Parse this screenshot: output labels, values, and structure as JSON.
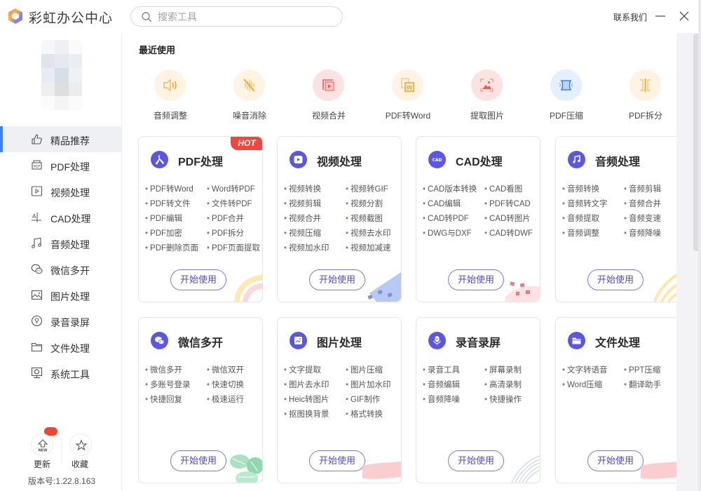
{
  "app": {
    "title": "彩虹办公中心",
    "contact_label": "联系我们",
    "minimize_icon": "minimize-icon",
    "close_icon": "close-icon"
  },
  "search": {
    "placeholder": "搜索工具",
    "value": "",
    "icon": "search-icon"
  },
  "sidebar": {
    "active_index": 0,
    "accent_color": "#3b82f6",
    "items": [
      {
        "label": "精品推荐",
        "icon": "thumbs-up-icon"
      },
      {
        "label": "PDF处理",
        "icon": "pdf-file-icon"
      },
      {
        "label": "视频处理",
        "icon": "video-play-icon"
      },
      {
        "label": "CAD处理",
        "icon": "cad-icon"
      },
      {
        "label": "音频处理",
        "icon": "music-note-icon"
      },
      {
        "label": "微信多开",
        "icon": "wechat-icon"
      },
      {
        "label": "图片处理",
        "icon": "image-icon"
      },
      {
        "label": "录音录屏",
        "icon": "record-icon"
      },
      {
        "label": "文件处理",
        "icon": "folder-icon"
      },
      {
        "label": "系统工具",
        "icon": "monitor-gear-icon"
      }
    ],
    "update_label": "更新",
    "update_icon_text": "NEW",
    "favorites_label": "收藏",
    "version": "版本号:1.22.8.163"
  },
  "recent": {
    "title": "最近使用",
    "items": [
      {
        "label": "音频调整",
        "icon": "speaker-icon",
        "bg": "#fff4e6",
        "fg": "#f8b35a"
      },
      {
        "label": "噪音消除",
        "icon": "noise-off-icon",
        "bg": "#fff4e6",
        "fg": "#f5a623"
      },
      {
        "label": "视频合并",
        "icon": "video-merge-icon",
        "bg": "#fde4e4",
        "fg": "#ef5b5b"
      },
      {
        "label": "PDF转Word",
        "icon": "pdf-to-word-icon",
        "bg": "#fff4e6",
        "fg": "#f5a623"
      },
      {
        "label": "提取图片",
        "icon": "extract-image-icon",
        "bg": "#fde4e4",
        "fg": "#ef5b5b"
      },
      {
        "label": "PDF压缩",
        "icon": "pdf-compress-icon",
        "bg": "#e6f0ff",
        "fg": "#3b82f6"
      },
      {
        "label": "PDF拆分",
        "icon": "pdf-split-icon",
        "bg": "#fff4e6",
        "fg": "#f5a623"
      }
    ]
  },
  "cards": [
    {
      "title": "PDF处理",
      "icon": "pdf-acrobat-icon",
      "badge": "HOT",
      "features": [
        "PDF转Word",
        "Word转PDF",
        "PDF转文件",
        "文件转PDF",
        "PDF编辑",
        "PDF合并",
        "PDF加密",
        "PDF拆分",
        "PDF删除页面",
        "PDF页面提取"
      ],
      "button": "开始使用"
    },
    {
      "title": "视频处理",
      "icon": "video-play-icon",
      "features": [
        "视频转换",
        "视频转GIF",
        "视频剪辑",
        "视频分割",
        "视频合并",
        "视频截图",
        "视频压缩",
        "视频去水印",
        "视频加水印",
        "视频加减速"
      ],
      "button": "开始使用"
    },
    {
      "title": "CAD处理",
      "icon": "cad-badge-icon",
      "features": [
        "CAD版本转换",
        "CAD看图",
        "CAD编辑",
        "PDF转CAD",
        "CAD转PDF",
        "CAD转图片",
        "DWG与DXF",
        "CAD转DWF"
      ],
      "button": "开始使用"
    },
    {
      "title": "音频处理",
      "icon": "music-note-icon",
      "features": [
        "音频转换",
        "音频剪辑",
        "音频转文字",
        "音频合并",
        "音频提取",
        "音频变速",
        "音频调整",
        "音频降噪"
      ],
      "button": "开始使用"
    },
    {
      "title": "微信多开",
      "icon": "wechat-icon",
      "features": [
        "微信多开",
        "微信双开",
        "多账号登录",
        "快速切换",
        "快捷回复",
        "极速运行"
      ],
      "button": "开始使用"
    },
    {
      "title": "图片处理",
      "icon": "image-icon",
      "features": [
        "文字提取",
        "图片压缩",
        "图片去水印",
        "图片加水印",
        "Heic转图片",
        "GIF制作",
        "抠图换背景",
        "格式转换"
      ],
      "button": "开始使用"
    },
    {
      "title": "录音录屏",
      "icon": "microphone-icon",
      "features": [
        "录音工具",
        "屏幕录制",
        "音频编辑",
        "高清录制",
        "音频降噪",
        "快捷操作"
      ],
      "button": "开始使用"
    },
    {
      "title": "文件处理",
      "icon": "folder-icon",
      "features": [
        "文字转语音",
        "PPT压缩",
        "Word压缩",
        "翻译助手"
      ],
      "button": "开始使用"
    }
  ],
  "colors": {
    "brand_purple": "#5b57e6",
    "hot_red": "#f5443a",
    "text_dark": "#2b2b2b"
  }
}
